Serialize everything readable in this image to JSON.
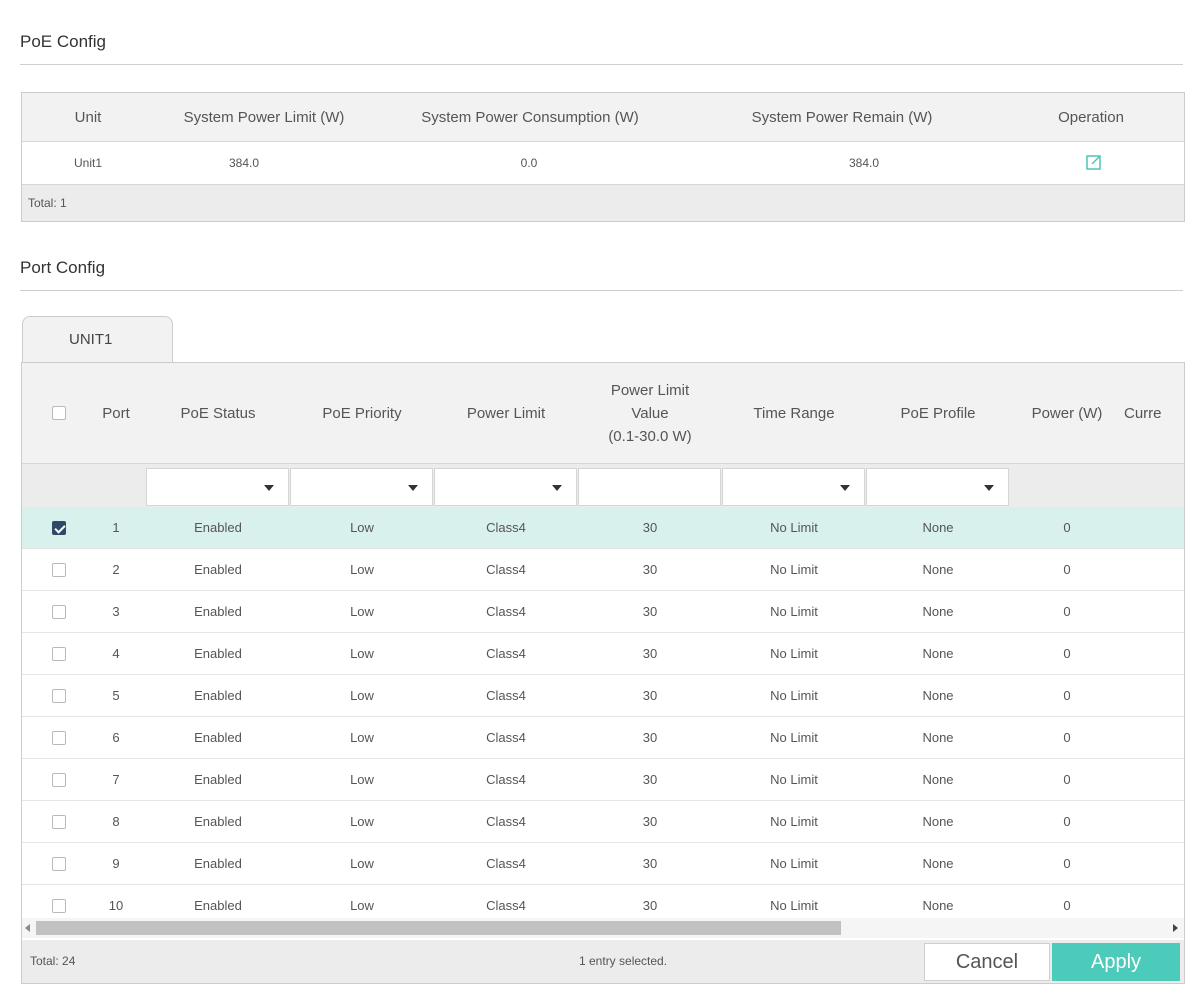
{
  "poe_config": {
    "title": "PoE Config",
    "columns": [
      "Unit",
      "System Power Limit (W)",
      "System Power Consumption (W)",
      "System Power Remain (W)",
      "Operation"
    ],
    "rows": [
      {
        "unit": "Unit1",
        "limit": "384.0",
        "consumption": "0.0",
        "remain": "384.0"
      }
    ],
    "total": "Total: 1",
    "edit_icon": "edit-icon"
  },
  "port_config": {
    "title": "Port Config",
    "tab": "UNIT1",
    "columns": {
      "port": "Port",
      "poe_status": "PoE Status",
      "poe_priority": "PoE Priority",
      "power_limit": "Power Limit",
      "power_limit_value_1": "Power Limit",
      "power_limit_value_2": "Value",
      "power_limit_value_3": "(0.1-30.0 W)",
      "time_range": "Time Range",
      "poe_profile": "PoE Profile",
      "power": "Power (W)",
      "current": "Curre"
    },
    "rows": [
      {
        "checked": true,
        "port": "1",
        "status": "Enabled",
        "priority": "Low",
        "limit": "Class4",
        "value": "30",
        "time": "No Limit",
        "profile": "None",
        "power": "0"
      },
      {
        "checked": false,
        "port": "2",
        "status": "Enabled",
        "priority": "Low",
        "limit": "Class4",
        "value": "30",
        "time": "No Limit",
        "profile": "None",
        "power": "0"
      },
      {
        "checked": false,
        "port": "3",
        "status": "Enabled",
        "priority": "Low",
        "limit": "Class4",
        "value": "30",
        "time": "No Limit",
        "profile": "None",
        "power": "0"
      },
      {
        "checked": false,
        "port": "4",
        "status": "Enabled",
        "priority": "Low",
        "limit": "Class4",
        "value": "30",
        "time": "No Limit",
        "profile": "None",
        "power": "0"
      },
      {
        "checked": false,
        "port": "5",
        "status": "Enabled",
        "priority": "Low",
        "limit": "Class4",
        "value": "30",
        "time": "No Limit",
        "profile": "None",
        "power": "0"
      },
      {
        "checked": false,
        "port": "6",
        "status": "Enabled",
        "priority": "Low",
        "limit": "Class4",
        "value": "30",
        "time": "No Limit",
        "profile": "None",
        "power": "0"
      },
      {
        "checked": false,
        "port": "7",
        "status": "Enabled",
        "priority": "Low",
        "limit": "Class4",
        "value": "30",
        "time": "No Limit",
        "profile": "None",
        "power": "0"
      },
      {
        "checked": false,
        "port": "8",
        "status": "Enabled",
        "priority": "Low",
        "limit": "Class4",
        "value": "30",
        "time": "No Limit",
        "profile": "None",
        "power": "0"
      },
      {
        "checked": false,
        "port": "9",
        "status": "Enabled",
        "priority": "Low",
        "limit": "Class4",
        "value": "30",
        "time": "No Limit",
        "profile": "None",
        "power": "0"
      },
      {
        "checked": false,
        "port": "10",
        "status": "Enabled",
        "priority": "Low",
        "limit": "Class4",
        "value": "30",
        "time": "No Limit",
        "profile": "None",
        "power": "0"
      }
    ],
    "total": "Total: 24",
    "selected_text": "1 entry selected.",
    "cancel_label": "Cancel",
    "apply_label": "Apply",
    "colors": {
      "accent": "#4ccaba",
      "selected_row": "#d8f1ec",
      "checkbox_checked": "#2d4a66"
    }
  }
}
